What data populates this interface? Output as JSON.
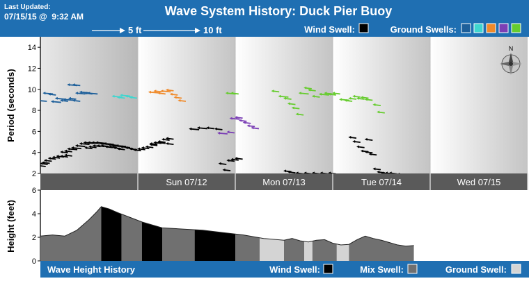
{
  "header": {
    "last_updated_label": "Last Updated:",
    "last_updated_value": "07/15/15 @  9:32 AM",
    "title": "Wave System History: Duck Pier Buoy",
    "arrow_5ft": "5 ft",
    "arrow_10ft": "10 ft",
    "wind_swell_label": "Wind Swell:",
    "ground_swells_label": "Ground Swells:"
  },
  "colors": {
    "header_bg": "#1f6fb2",
    "footer_bg": "#1f6fb2",
    "date_bar": "#5a5a5a",
    "wind_swell": "#000000",
    "mix_swell": "#707070",
    "ground_swell": "#d4d4d4",
    "ground_swell_palette": [
      "#1d5f9a",
      "#3fd6cf",
      "#f08a2a",
      "#7b3fb5",
      "#66cc2e"
    ]
  },
  "footer": {
    "title": "Wave Height History",
    "wind_swell_label": "Wind Swell:",
    "mix_swell_label": "Mix Swell:",
    "ground_swell_label": "Ground Swell:"
  },
  "compass_label": "N",
  "chart_data": [
    {
      "type": "scatter",
      "ylabel": "Period (seconds)",
      "ylim": [
        2,
        15
      ],
      "yticks": [
        2,
        4,
        6,
        8,
        10,
        12,
        14
      ],
      "x_unit": "hours from Sat 07/11 00:00",
      "xlim": [
        0,
        120
      ],
      "day_labels": [
        {
          "label": "Sun 07/12",
          "start": 24
        },
        {
          "label": "Mon 07/13",
          "start": 48
        },
        {
          "label": "Tue 07/14",
          "start": 72
        },
        {
          "label": "Wed 07/15",
          "start": 96
        }
      ],
      "series": [
        {
          "color": "#1d5f9a",
          "points": [
            [
              0.5,
              8.9,
              4
            ],
            [
              2,
              9.6,
              4
            ],
            [
              3,
              9.5,
              3
            ],
            [
              4,
              8.8,
              4
            ],
            [
              5,
              9.1,
              4
            ],
            [
              6,
              8.9,
              3
            ],
            [
              7,
              9.0,
              4
            ],
            [
              8,
              9.1,
              3
            ],
            [
              9,
              8.9,
              3
            ],
            [
              8,
              10.4,
              4
            ],
            [
              9,
              10.4,
              3
            ],
            [
              10,
              9.6,
              4
            ],
            [
              11,
              9.7,
              4
            ],
            [
              12,
              9.6,
              3
            ],
            [
              13,
              9.6,
              4
            ]
          ]
        },
        {
          "color": "#3fd6cf",
          "points": [
            [
              19,
              9.3,
              4
            ],
            [
              20,
              9.2,
              3
            ],
            [
              21,
              9.4,
              4
            ],
            [
              22,
              9.3,
              3
            ],
            [
              23,
              9.2,
              3
            ]
          ]
        },
        {
          "color": "#f08a2a",
          "points": [
            [
              28,
              9.7,
              4
            ],
            [
              29,
              9.8,
              3
            ],
            [
              30,
              9.6,
              3
            ],
            [
              31,
              9.8,
              4
            ],
            [
              32,
              9.9,
              3
            ],
            [
              33,
              9.5,
              3
            ],
            [
              34,
              9.2,
              3
            ],
            [
              35,
              8.9,
              3
            ]
          ]
        },
        {
          "color": "#7b3fb5",
          "points": [
            [
              45,
              5.8,
              4
            ],
            [
              47,
              5.9,
              3
            ],
            [
              48,
              7.2,
              4
            ],
            [
              49,
              7.3,
              3
            ],
            [
              50,
              7.0,
              3
            ],
            [
              51,
              6.8,
              3
            ],
            [
              52,
              6.5,
              3
            ],
            [
              53,
              6.3,
              3
            ]
          ]
        },
        {
          "color": "#66cc2e",
          "points": [
            [
              47,
              9.6,
              4
            ],
            [
              48,
              9.6,
              3
            ],
            [
              58,
              9.8,
              3
            ],
            [
              60,
              9.3,
              4
            ],
            [
              61,
              9.1,
              3
            ],
            [
              62,
              8.6,
              3
            ],
            [
              63,
              8.2,
              3
            ],
            [
              64,
              7.6,
              3
            ],
            [
              65,
              9.6,
              4
            ],
            [
              66,
              10.1,
              3
            ],
            [
              67,
              9.9,
              3
            ],
            [
              68,
              9.3,
              3
            ],
            [
              70,
              9.5,
              4
            ],
            [
              71,
              9.6,
              3
            ],
            [
              72,
              9.5,
              3
            ],
            [
              73,
              9.6,
              3
            ],
            [
              75,
              9.0,
              4
            ],
            [
              76,
              8.9,
              3
            ],
            [
              77,
              9.1,
              3
            ],
            [
              78,
              9.3,
              3
            ],
            [
              79,
              9.1,
              3
            ],
            [
              80,
              9.2,
              3
            ],
            [
              81,
              9.0,
              3
            ],
            [
              83,
              8.5,
              3
            ],
            [
              84,
              7.8,
              3
            ]
          ]
        },
        {
          "color": "#000000",
          "points": [
            [
              0.5,
              2.7,
              3
            ],
            [
              1,
              2.9,
              3
            ],
            [
              1.5,
              3.0,
              3
            ],
            [
              2,
              3.2,
              3
            ],
            [
              3,
              3.4,
              3
            ],
            [
              4,
              3.5,
              3
            ],
            [
              5,
              3.6,
              3
            ],
            [
              6,
              3.6,
              3
            ],
            [
              7,
              3.7,
              3
            ],
            [
              6,
              4.0,
              3
            ],
            [
              7,
              4.1,
              3
            ],
            [
              8,
              4.3,
              4
            ],
            [
              9,
              4.4,
              4
            ],
            [
              10,
              4.6,
              4
            ],
            [
              11,
              4.8,
              4
            ],
            [
              12,
              4.9,
              4
            ],
            [
              13,
              4.9,
              4
            ],
            [
              14,
              4.9,
              4
            ],
            [
              15,
              4.9,
              4
            ],
            [
              16,
              4.8,
              4
            ],
            [
              17,
              4.8,
              4
            ],
            [
              18,
              4.7,
              4
            ],
            [
              19,
              4.6,
              4
            ],
            [
              20,
              4.6,
              4
            ],
            [
              21,
              4.5,
              4
            ],
            [
              22,
              4.4,
              3
            ],
            [
              23,
              4.3,
              3
            ],
            [
              12,
              4.4,
              3
            ],
            [
              13,
              4.5,
              3
            ],
            [
              14,
              4.6,
              3
            ],
            [
              15,
              4.6,
              3
            ],
            [
              16,
              4.6,
              3
            ],
            [
              17,
              4.5,
              3
            ],
            [
              18,
              4.5,
              3
            ],
            [
              19,
              4.4,
              3
            ],
            [
              20,
              4.3,
              3
            ],
            [
              24,
              4.2,
              3
            ],
            [
              25,
              4.3,
              3
            ],
            [
              26,
              4.4,
              3
            ],
            [
              27,
              4.5,
              3
            ],
            [
              28,
              4.7,
              3
            ],
            [
              29,
              4.9,
              3
            ],
            [
              30,
              5.0,
              3
            ],
            [
              31,
              5.2,
              3
            ],
            [
              32,
              5.3,
              3
            ],
            [
              28,
              4.8,
              3
            ],
            [
              30,
              4.9,
              3
            ],
            [
              32,
              4.8,
              3
            ],
            [
              38,
              6.2,
              4
            ],
            [
              40,
              6.3,
              4
            ],
            [
              42,
              6.3,
              3
            ],
            [
              44,
              6.2,
              3
            ],
            [
              45,
              2.9,
              3
            ],
            [
              46,
              2.3,
              3
            ],
            [
              47,
              3.2,
              3
            ],
            [
              48,
              3.3,
              3
            ],
            [
              49,
              3.4,
              3
            ],
            [
              61,
              2.2,
              3
            ],
            [
              62,
              2.1,
              3
            ],
            [
              64,
              2.0,
              3
            ],
            [
              66,
              2.0,
              3
            ],
            [
              68,
              2.0,
              3
            ],
            [
              70,
              2.0,
              3
            ],
            [
              72,
              2.0,
              3
            ],
            [
              77,
              5.4,
              3
            ],
            [
              78,
              5.0,
              3
            ],
            [
              79,
              4.5,
              3
            ],
            [
              80,
              4.1,
              3
            ],
            [
              81,
              4.0,
              3
            ],
            [
              82,
              3.8,
              3
            ],
            [
              81,
              5.2,
              3
            ],
            [
              83,
              2.4,
              3
            ],
            [
              84,
              2.1,
              3
            ],
            [
              85,
              2.0,
              3
            ],
            [
              86,
              2.0,
              3
            ],
            [
              87,
              2.0,
              3
            ],
            [
              89,
              1.9,
              3
            ]
          ]
        }
      ]
    },
    {
      "type": "area",
      "ylabel": "Height (feet)",
      "ylim": [
        0,
        6
      ],
      "yticks": [
        0,
        2,
        4,
        6
      ],
      "x_unit": "hours from Sat 07/11 00:00",
      "xlim": [
        0,
        120
      ],
      "type_segments": [
        {
          "start": 0,
          "end": 15,
          "kind": "mix"
        },
        {
          "start": 15,
          "end": 20,
          "kind": "wind"
        },
        {
          "start": 20,
          "end": 25,
          "kind": "mix"
        },
        {
          "start": 25,
          "end": 30,
          "kind": "wind"
        },
        {
          "start": 30,
          "end": 38,
          "kind": "mix"
        },
        {
          "start": 38,
          "end": 48,
          "kind": "wind"
        },
        {
          "start": 48,
          "end": 54,
          "kind": "mix"
        },
        {
          "start": 54,
          "end": 60,
          "kind": "ground"
        },
        {
          "start": 60,
          "end": 65,
          "kind": "mix"
        },
        {
          "start": 65,
          "end": 67,
          "kind": "ground"
        },
        {
          "start": 67,
          "end": 73,
          "kind": "mix"
        },
        {
          "start": 73,
          "end": 76,
          "kind": "ground"
        },
        {
          "start": 76,
          "end": 92,
          "kind": "mix"
        }
      ],
      "x": [
        0,
        3,
        6,
        9,
        12,
        14,
        15,
        17,
        19,
        22,
        25,
        30,
        35,
        40,
        45,
        50,
        55,
        60,
        62,
        64,
        66,
        68,
        70,
        72,
        74,
        76,
        78,
        80,
        82,
        84,
        86,
        88,
        90,
        92
      ],
      "y": [
        2.1,
        2.2,
        2.1,
        2.6,
        3.5,
        4.2,
        4.6,
        4.4,
        4.1,
        3.7,
        3.3,
        2.8,
        2.7,
        2.6,
        2.4,
        2.2,
        1.9,
        1.75,
        1.9,
        1.7,
        1.6,
        1.75,
        1.8,
        1.5,
        1.35,
        1.4,
        1.8,
        2.1,
        1.9,
        1.75,
        1.55,
        1.35,
        1.25,
        1.3
      ]
    }
  ]
}
